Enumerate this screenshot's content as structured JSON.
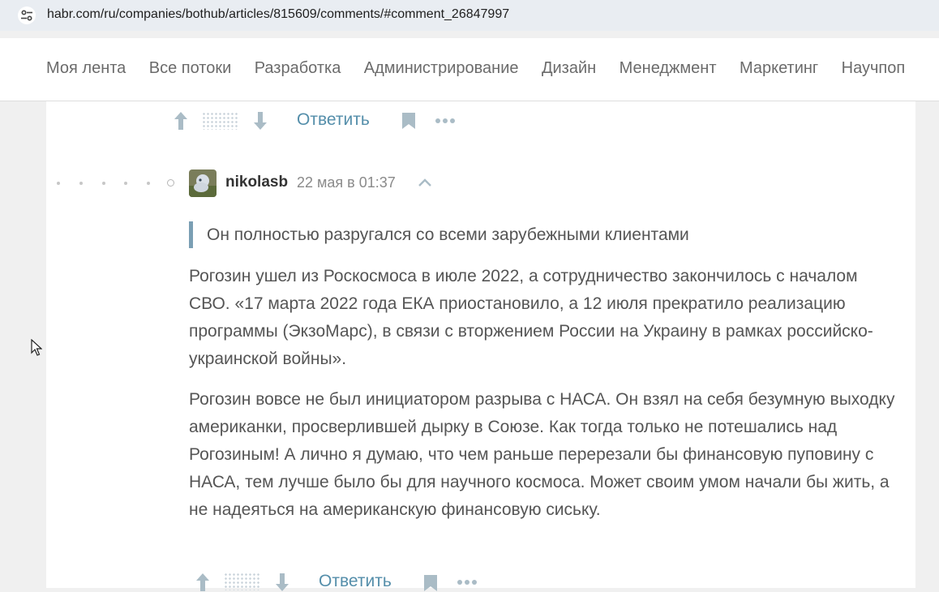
{
  "browser": {
    "url": "habr.com/ru/companies/bothub/articles/815609/comments/#comment_26847997",
    "site_info_icon": "tune-icon"
  },
  "nav": {
    "items": [
      {
        "label": "Моя лента"
      },
      {
        "label": "Все потоки"
      },
      {
        "label": "Разработка"
      },
      {
        "label": "Администрирование"
      },
      {
        "label": "Дизайн"
      },
      {
        "label": "Менеджмент"
      },
      {
        "label": "Маркетинг"
      },
      {
        "label": "Научпоп"
      }
    ]
  },
  "prev_comment_actions": {
    "reply_label": "Ответить"
  },
  "comment": {
    "username": "nikolasb",
    "timestamp": "22 мая в 01:37",
    "quote": "Он полностью разругался со всеми зарубежными клиентами",
    "paragraphs": [
      "Рогозин ушел из Роскосмоса в июле 2022, а сотрудничество закончилось с началом СВО. «17 марта 2022 года ЕКА приостановило, а 12 июля прекратило реализацию программы (ЭкзоМарс), в связи с вторжением России на Украину в рамках российско-украинской войны».",
      "Рогозин вовсе не был инициатором разрыва с НАСА. Он взял на себя безумную выходку американки, просверлившей дырку в Союзе. Как тогда только не потешались над Рогозиным! А лично я думаю, что чем раньше перерезали бы финансовую пуповину с НАСА, тем лучше было бы для научного космоса. Может своим умом начали бы жить, а не надеяться на американскую финансовую сиську."
    ],
    "reply_label": "Ответить"
  },
  "colors": {
    "accent": "#548eaa",
    "icon_gray": "#aabcc6",
    "quote_bar": "#7b9fb4",
    "text": "#555555",
    "page_bg": "#f0f0f0"
  }
}
